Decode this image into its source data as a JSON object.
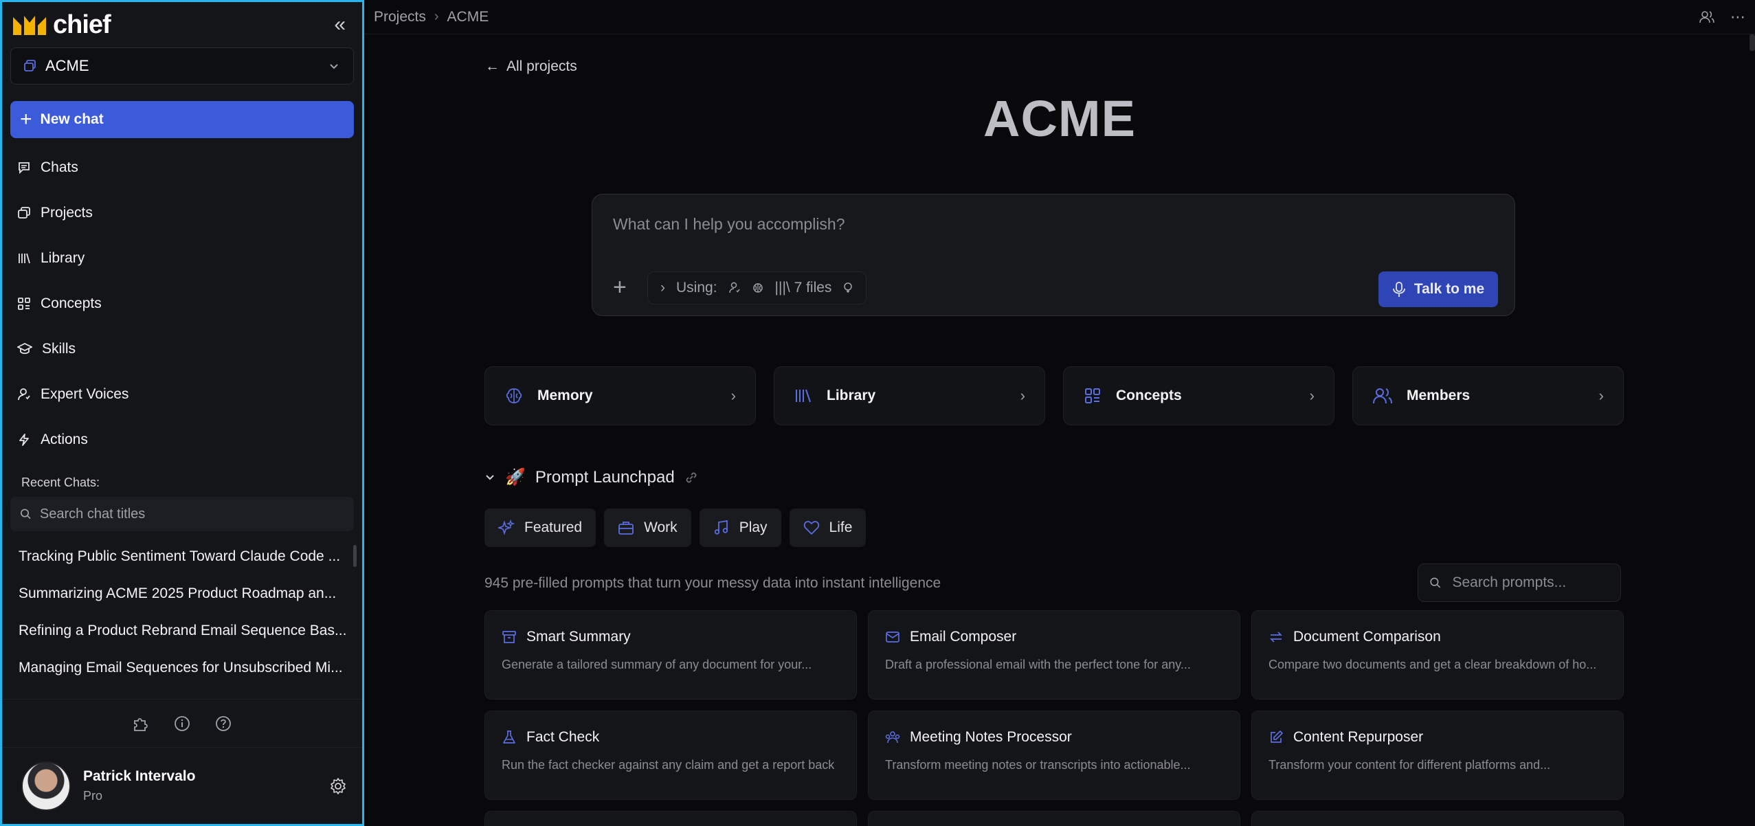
{
  "brand": {
    "name": "chief",
    "logo_color": "#f5b301"
  },
  "sidebar": {
    "project": "ACME",
    "new_chat": "New chat",
    "nav": [
      {
        "label": "Chats",
        "icon": "chat-bubble-icon"
      },
      {
        "label": "Projects",
        "icon": "folders-icon"
      },
      {
        "label": "Library",
        "icon": "library-icon"
      },
      {
        "label": "Concepts",
        "icon": "concepts-grid-icon"
      },
      {
        "label": "Skills",
        "icon": "graduation-cap-icon"
      },
      {
        "label": "Expert Voices",
        "icon": "user-voice-icon"
      },
      {
        "label": "Actions",
        "icon": "lightning-icon"
      }
    ],
    "recent_label": "Recent Chats:",
    "search_placeholder": "Search chat titles",
    "recent_chats": [
      "Tracking Public Sentiment Toward Claude Code ...",
      "Summarizing ACME 2025 Product Roadmap an...",
      "Refining a Product Rebrand Email Sequence Bas...",
      "Managing Email Sequences for Unsubscribed Mi..."
    ],
    "user": {
      "name": "Patrick Intervalo",
      "plan": "Pro"
    }
  },
  "topbar": {
    "crumbs": [
      "Projects",
      "ACME"
    ]
  },
  "main": {
    "back_label": "All projects",
    "title": "ACME",
    "prompt_placeholder": "What can I help you accomplish?",
    "using_label": "Using:",
    "files_label": "7 files",
    "talk_button": "Talk to me",
    "quick_links": [
      {
        "label": "Memory",
        "icon": "brain-icon"
      },
      {
        "label": "Library",
        "icon": "library-icon"
      },
      {
        "label": "Concepts",
        "icon": "concepts-grid-icon"
      },
      {
        "label": "Members",
        "icon": "members-icon"
      }
    ],
    "launchpad_title": "Prompt Launchpad",
    "tabs": [
      {
        "label": "Featured",
        "icon": "sparkles-icon"
      },
      {
        "label": "Work",
        "icon": "briefcase-icon"
      },
      {
        "label": "Play",
        "icon": "music-note-icon"
      },
      {
        "label": "Life",
        "icon": "heart-icon"
      }
    ],
    "prompt_count_text": "945 pre-filled prompts that turn your messy data into instant intelligence",
    "prompt_search_placeholder": "Search prompts...",
    "cards": [
      {
        "title": "Smart Summary",
        "desc": "Generate a tailored summary of any document for your...",
        "icon": "archive-box-icon"
      },
      {
        "title": "Email Composer",
        "desc": "Draft a professional email with the perfect tone for any...",
        "icon": "envelope-icon"
      },
      {
        "title": "Document Comparison",
        "desc": "Compare two documents and get a clear breakdown of ho...",
        "icon": "compare-arrows-icon"
      },
      {
        "title": "Fact Check",
        "desc": "Run the fact checker against any claim and get a report back",
        "icon": "flask-icon"
      },
      {
        "title": "Meeting Notes Processor",
        "desc": "Transform meeting notes or transcripts into actionable...",
        "icon": "meeting-group-icon"
      },
      {
        "title": "Content Repurposer",
        "desc": "Transform your content for different platforms and...",
        "icon": "pencil-square-icon"
      }
    ]
  },
  "colors": {
    "accent": "#3b5bdb",
    "icon_accent": "#5b6ee1",
    "sidebar_border": "#22b8ee"
  }
}
